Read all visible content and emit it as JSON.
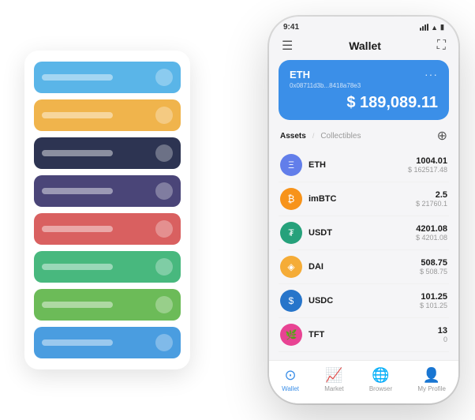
{
  "scene": {
    "background": "#ffffff"
  },
  "card_list": {
    "cards": [
      {
        "color": "#5ab5e8",
        "icon": "💎"
      },
      {
        "color": "#f0b44c",
        "icon": "🏷️"
      },
      {
        "color": "#2d3452",
        "icon": "⚙️"
      },
      {
        "color": "#4a4578",
        "icon": "🔷"
      },
      {
        "color": "#d96060",
        "icon": "🔴"
      },
      {
        "color": "#48b87e",
        "icon": "🟢"
      },
      {
        "color": "#6cbb58",
        "icon": "💚"
      },
      {
        "color": "#4a9de0",
        "icon": "🔵"
      }
    ]
  },
  "phone": {
    "status_time": "9:41",
    "title": "Wallet",
    "eth_card": {
      "name": "ETH",
      "address": "0x08711d3b...8418a78e3",
      "balance": "$ 189,089.11",
      "color": "#3b8fe8"
    },
    "assets_tab_active": "Assets",
    "assets_tab_divider": "/",
    "assets_tab_inactive": "Collectibles",
    "assets": [
      {
        "symbol": "ETH",
        "amount": "1004.01",
        "usd": "$ 162517.48",
        "icon_color": "#627EEA",
        "icon_text": "Ξ"
      },
      {
        "symbol": "imBTC",
        "amount": "2.5",
        "usd": "$ 21760.1",
        "icon_color": "#F7931A",
        "icon_text": "₿"
      },
      {
        "symbol": "USDT",
        "amount": "4201.08",
        "usd": "$ 4201.08",
        "icon_color": "#26A17B",
        "icon_text": "₮"
      },
      {
        "symbol": "DAI",
        "amount": "508.75",
        "usd": "$ 508.75",
        "icon_color": "#F5AC37",
        "icon_text": "◈"
      },
      {
        "symbol": "USDC",
        "amount": "101.25",
        "usd": "$ 101.25",
        "icon_color": "#2775CA",
        "icon_text": "$"
      },
      {
        "symbol": "TFT",
        "amount": "13",
        "usd": "0",
        "icon_color": "#e84393",
        "icon_text": "🌿"
      }
    ],
    "nav": [
      {
        "label": "Wallet",
        "icon": "⊙",
        "active": true
      },
      {
        "label": "Market",
        "icon": "📊",
        "active": false
      },
      {
        "label": "Browser",
        "icon": "👤",
        "active": false
      },
      {
        "label": "My Profile",
        "icon": "👤",
        "active": false
      }
    ]
  }
}
